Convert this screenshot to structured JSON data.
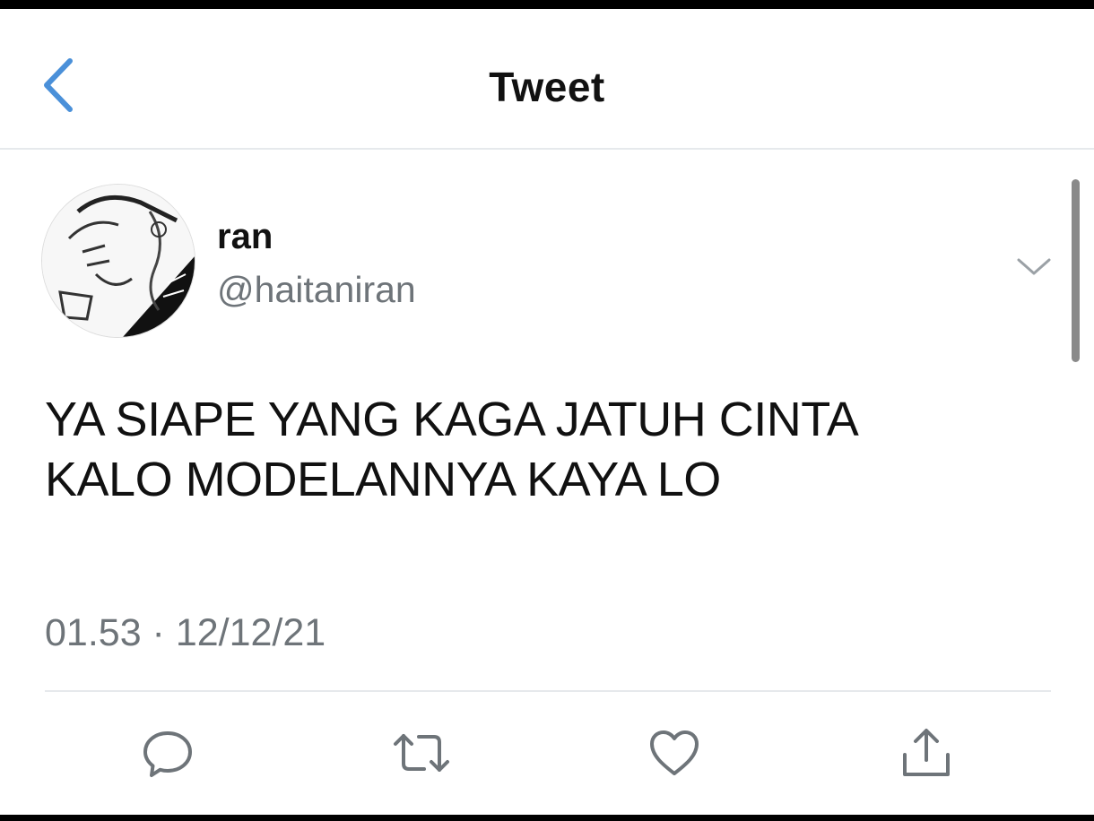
{
  "header": {
    "title": "Tweet",
    "back_icon": "chevron-left-icon"
  },
  "tweet": {
    "author": {
      "name": "ran",
      "handle": "@haitaniran"
    },
    "text": "YA SIAPE YANG KAGA JATUH CINTA\nKALO MODELANNYA KAYA LO",
    "timestamp": "01.53 · 12/12/21",
    "more_icon": "chevron-down-icon"
  },
  "actions": [
    {
      "icon": "reply-icon"
    },
    {
      "icon": "retweet-icon"
    },
    {
      "icon": "like-icon"
    },
    {
      "icon": "share-icon"
    }
  ],
  "colors": {
    "accent": "#4a90d9",
    "text": "#111111",
    "secondary": "#6e7479",
    "divider": "#e6e9ec",
    "icon": "#6e7479"
  }
}
